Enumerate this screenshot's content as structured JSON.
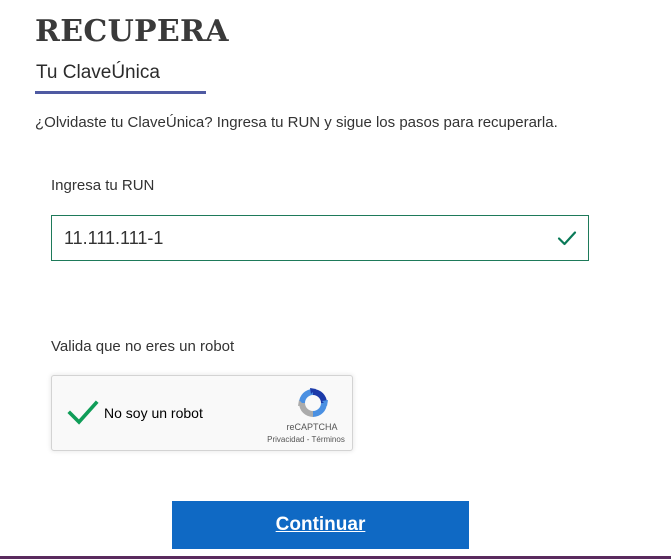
{
  "header": {
    "title": "RECUPERA",
    "subtitle": "Tu ClaveÚnica"
  },
  "intro": "¿Olvidaste tu ClaveÚnica? Ingresa tu RUN y sigue los pasos para recuperarla.",
  "run_field": {
    "label": "Ingresa tu RUN",
    "value": "11.111.111-1",
    "status_icon": "check-icon"
  },
  "captcha": {
    "label": "Valida que no eres un robot",
    "checkbox_text": "No soy un robot",
    "brand": "reCAPTCHA",
    "privacy": "Privacidad",
    "separator": " - ",
    "terms": "Términos",
    "checked": true
  },
  "actions": {
    "continue_label": "Continuar"
  },
  "colors": {
    "accent_underline": "#4f5aa2",
    "input_border_valid": "#1e7a5a",
    "check_green": "#0a7a58",
    "button_bg": "#0f69c4",
    "bottom_bar": "#5a2a5e"
  }
}
